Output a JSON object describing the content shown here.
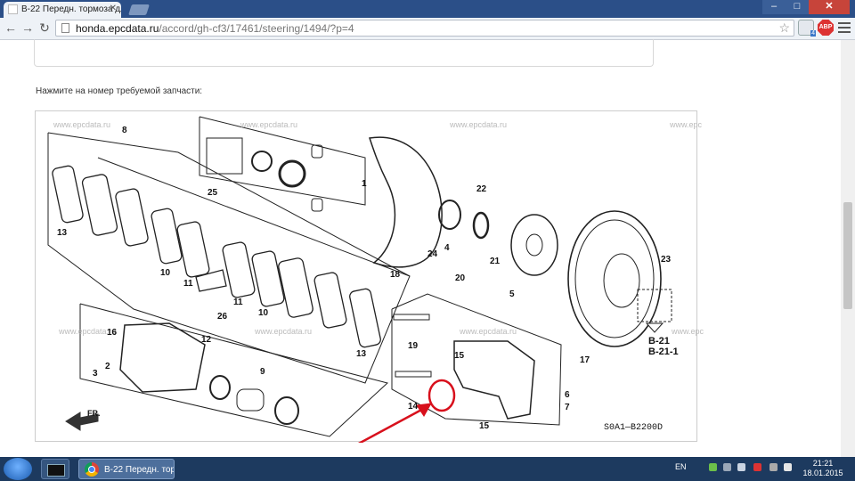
{
  "browser": {
    "tab_title": "B-22 Передн. тормоза дл",
    "url_host": "honda.epcdata.ru",
    "url_path": "/accord/gh-cf3/17461/steering/1494/?p=4",
    "abp_label": "ABP",
    "ext_badge": "4"
  },
  "page": {
    "instruction": "Нажмите на номер требуемой запчасти:",
    "watermark": "www.epcdata.ru",
    "diagram_code": "S0A1—B2200D",
    "front_label": "FR.",
    "refs": [
      "B-21",
      "B-21-1"
    ],
    "part_numbers": [
      "8",
      "1",
      "25",
      "22",
      "13",
      "10",
      "11",
      "4",
      "24",
      "21",
      "5",
      "18",
      "23",
      "20",
      "16",
      "26",
      "10",
      "11",
      "19",
      "12",
      "2",
      "3",
      "9",
      "14",
      "15",
      "6",
      "7",
      "17",
      "15",
      "13"
    ]
  },
  "taskbar": {
    "chrome_label": "B-22 Передн. тор...",
    "lang": "EN",
    "time": "21:21",
    "date": "18.01.2015"
  },
  "colors": {
    "tabstrip": "#2b4f88",
    "taskbar": "#1d3a5f",
    "highlight": "#d8101c"
  }
}
